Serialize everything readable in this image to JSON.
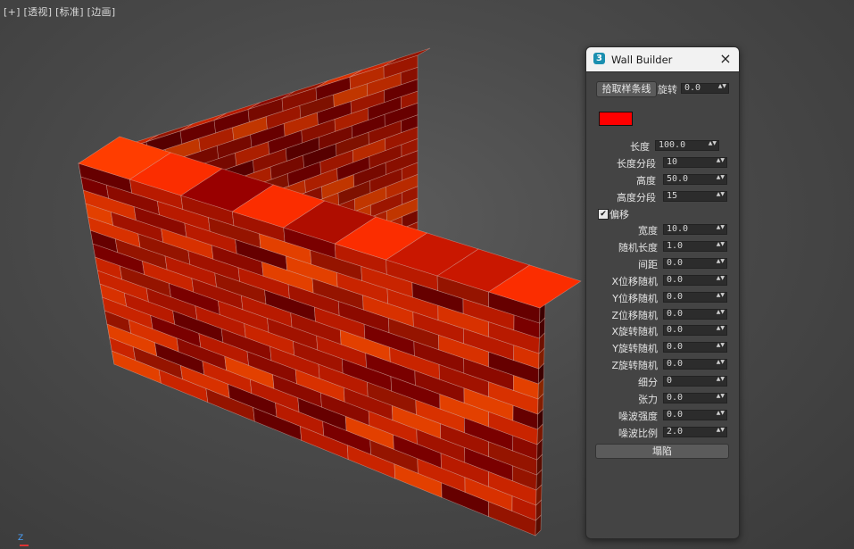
{
  "viewport": {
    "label": "[+] [透视] [标准] [边画]"
  },
  "scene": {
    "brick_color": "#ff0000",
    "axis_label": "Z"
  },
  "panel": {
    "title": "Wall Builder",
    "app_icon": "3",
    "close_icon": "×",
    "pick_button": "拾取样条线",
    "rotate": {
      "label": "旋转",
      "value": "0.0"
    },
    "color": "#ff0000",
    "params": [
      {
        "label": "长度",
        "value": "100.0"
      },
      {
        "label": "长度分段",
        "value": "10"
      },
      {
        "label": "高度",
        "value": "50.0"
      },
      {
        "label": "高度分段",
        "value": "15"
      }
    ],
    "offset": {
      "label": "偏移",
      "checked": true,
      "check_glyph": "✔"
    },
    "params2": [
      {
        "label": "宽度",
        "value": "10.0"
      },
      {
        "label": "随机长度",
        "value": "1.0"
      },
      {
        "label": "间距",
        "value": "0.0"
      },
      {
        "label": "X位移随机",
        "value": "0.0"
      },
      {
        "label": "Y位移随机",
        "value": "0.0"
      },
      {
        "label": "Z位移随机",
        "value": "0.0"
      },
      {
        "label": "X旋转随机",
        "value": "0.0"
      },
      {
        "label": "Y旋转随机",
        "value": "0.0"
      },
      {
        "label": "Z旋转随机",
        "value": "0.0"
      },
      {
        "label": "细分",
        "value": "0"
      },
      {
        "label": "张力",
        "value": "0.0"
      },
      {
        "label": "噪波强度",
        "value": "0.0"
      },
      {
        "label": "噪波比例",
        "value": "2.0"
      }
    ],
    "collapse_button": "塌陷",
    "spinner_arrows": "▲▼"
  }
}
